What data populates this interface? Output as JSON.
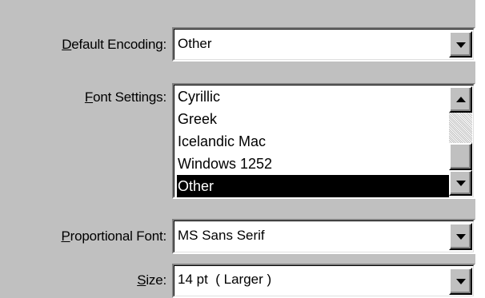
{
  "default_encoding": {
    "label_ul": "D",
    "label_rest": "efault Encoding:",
    "value": "Other"
  },
  "font_settings": {
    "label_ul": "F",
    "label_rest": "ont Settings:",
    "items": [
      "Cyrillic",
      "Greek",
      "Icelandic Mac",
      "Windows 1252",
      "Other"
    ],
    "selected_index": 4
  },
  "proportional_font": {
    "label_ul": "P",
    "label_rest": "roportional Font:",
    "value": "MS Sans Serif"
  },
  "size": {
    "label_ul": "S",
    "label_rest": "ize:",
    "value": "14 pt  ( Larger )"
  },
  "icons": {
    "dropdown": "triangle-down-icon",
    "scroll_up": "triangle-up-icon",
    "scroll_down": "triangle-down-icon"
  },
  "colors": {
    "face": "#c0c0c0",
    "selection_bg": "#000000",
    "selection_fg": "#ffffff"
  }
}
